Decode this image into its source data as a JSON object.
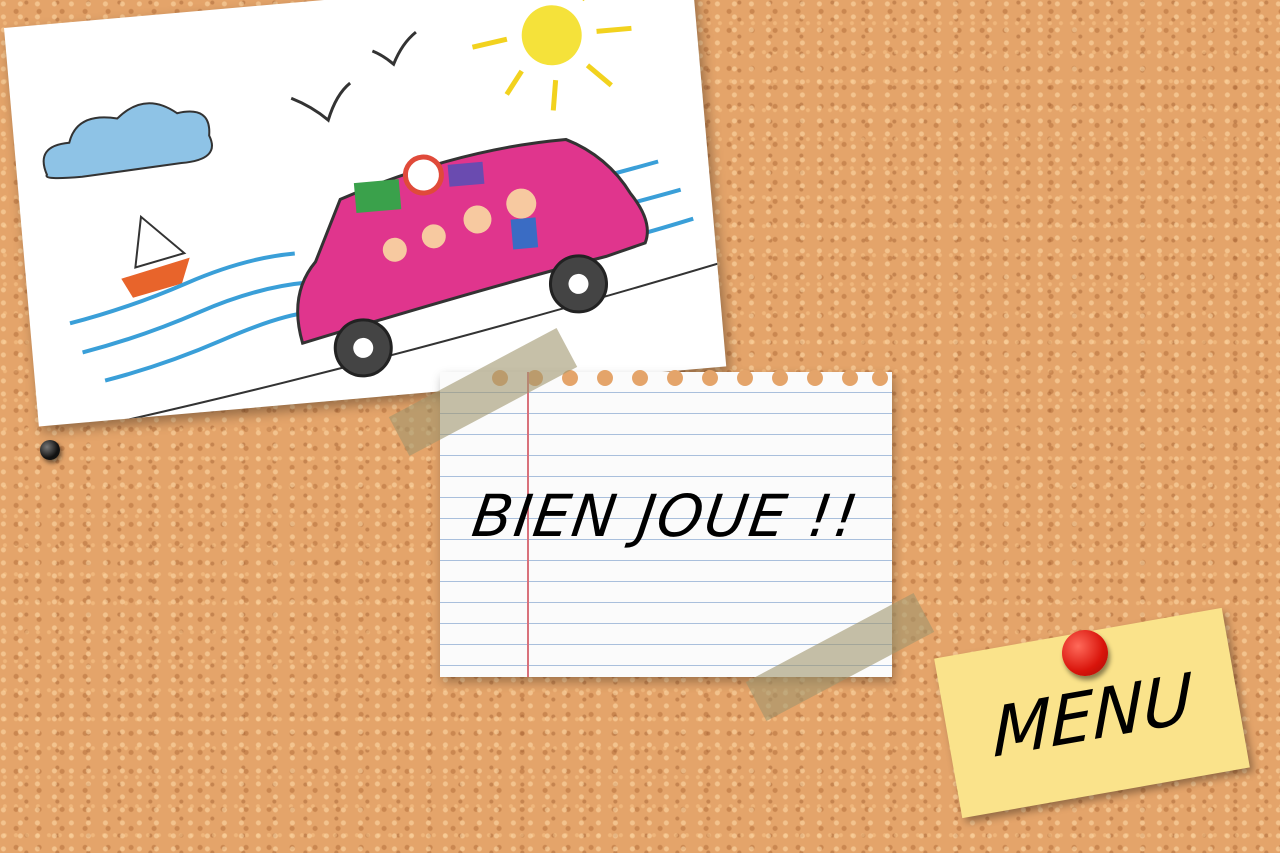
{
  "note": {
    "text": "BIEN JOUE !!"
  },
  "menu_button": {
    "label": "MENU"
  },
  "icons": [
    "child-drawing-image",
    "black-pushpin-icon",
    "red-pushpin-icon",
    "tape-icon"
  ],
  "colors": {
    "cork": "#e4a46a",
    "postit": "#fae38b",
    "pin_red": "#d9140b",
    "margin_line": "#d9717b"
  }
}
